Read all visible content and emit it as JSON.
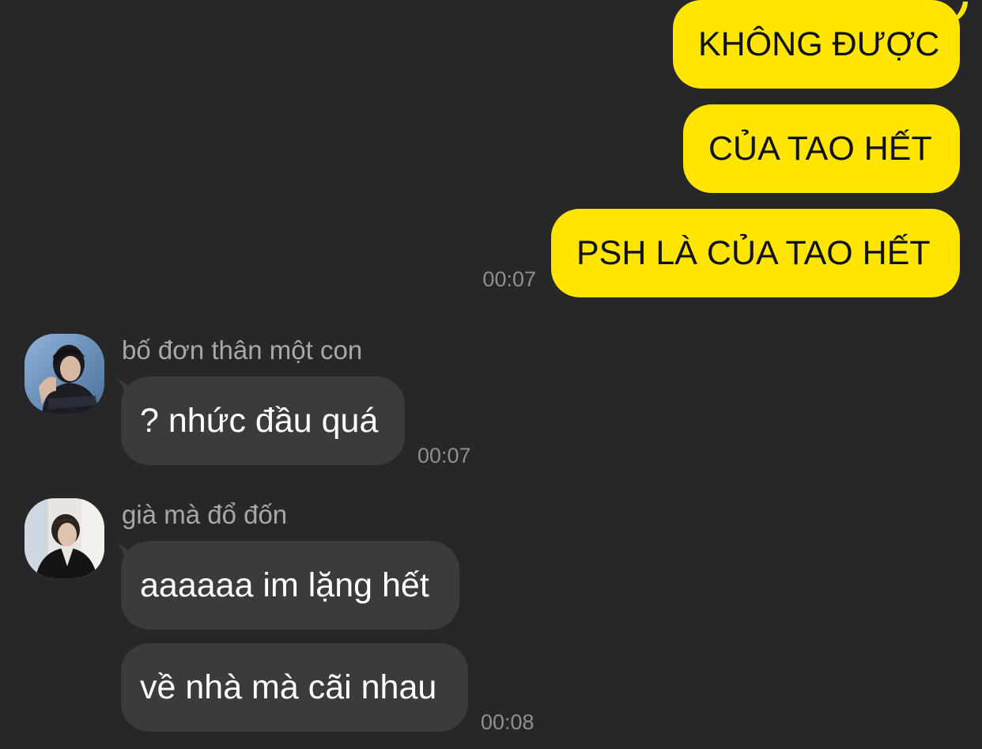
{
  "outgoing": [
    {
      "text": "KHÔNG ĐƯỢC"
    },
    {
      "text": "CỦA TAO HẾT"
    },
    {
      "text": "PSH LÀ CỦA TAO HẾT",
      "time": "00:07"
    }
  ],
  "incoming": [
    {
      "sender": "bố đơn thân một con",
      "avatar": "profile-photo-man-dark-hair",
      "messages": [
        {
          "text": "? nhức đầu quá",
          "time": "00:07"
        }
      ]
    },
    {
      "sender": "già mà đổ đốn",
      "avatar": "profile-photo-man-black-suit",
      "messages": [
        {
          "text": "aaaaaa im lặng hết"
        },
        {
          "text": "về nhà mà cãi nhau",
          "time": "00:08"
        }
      ]
    }
  ],
  "colors": {
    "background": "#272729",
    "outgoing_bubble": "#ffe500",
    "incoming_bubble": "#3b3b3d",
    "timestamp": "#8e8e93",
    "sender_name": "#a8a8ac"
  }
}
